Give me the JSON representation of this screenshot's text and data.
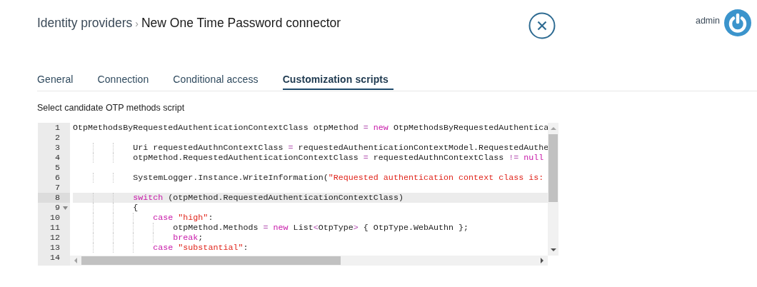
{
  "breadcrumb": [
    {
      "label": "Identity providers",
      "current": false
    },
    {
      "label": "New One Time Password connector",
      "current": true
    }
  ],
  "breadcrumb_separator": "›",
  "user": {
    "name": "admin"
  },
  "tabs": [
    {
      "label": "General",
      "selected": false
    },
    {
      "label": "Connection",
      "selected": false
    },
    {
      "label": "Conditional access",
      "selected": false
    },
    {
      "label": "Customization scripts",
      "selected": true
    }
  ],
  "script_label": "Select candidate OTP methods script",
  "editor": {
    "lines": [
      {
        "number": "1",
        "active": false,
        "tokens": [
          {
            "kind": "text",
            "text": "OtpMethodsByRequestedAuthenticationContextClass otpMethod "
          },
          {
            "kind": "operator",
            "text": "="
          },
          {
            "kind": "keyword",
            "text": " new"
          },
          {
            "kind": "text",
            "text": " OtpMethodsByRequestedAuthentica"
          }
        ]
      },
      {
        "number": "2",
        "active": false
      },
      {
        "number": "3",
        "active": false,
        "tokens": [
          {
            "kind": "text",
            "text": "            Uri requestedAuthnContextClass "
          },
          {
            "kind": "operator",
            "text": "="
          },
          {
            "kind": "text",
            "text": " requestedAuthenticationContextModel.RequestedAuthe"
          }
        ]
      },
      {
        "number": "4",
        "active": false,
        "tokens": [
          {
            "kind": "text",
            "text": "            otpMethod.RequestedAuthenticationContextClass "
          },
          {
            "kind": "operator",
            "text": "="
          },
          {
            "kind": "text",
            "text": " requestedAuthnContextClass "
          },
          {
            "kind": "operator",
            "text": "!="
          },
          {
            "kind": "keyword",
            "text": " null"
          }
        ]
      },
      {
        "number": "5",
        "active": false
      },
      {
        "number": "6",
        "active": false,
        "tokens": [
          {
            "kind": "text",
            "text": "            SystemLogger.Instance.WriteInformation("
          },
          {
            "kind": "string",
            "text": "\"Requested authentication context class is:"
          }
        ]
      },
      {
        "number": "7",
        "active": false
      },
      {
        "number": "8",
        "active": true,
        "tokens": [
          {
            "kind": "keyword",
            "text": "            switch"
          },
          {
            "kind": "text",
            "text": " (otpMethod.RequestedAuthenticationContextClass)"
          }
        ]
      },
      {
        "number": "9",
        "active": false,
        "expanded": true,
        "tokens": [
          {
            "kind": "text",
            "text": "            {"
          }
        ]
      },
      {
        "number": "10",
        "active": false,
        "tokens": [
          {
            "kind": "keyword",
            "text": "                case"
          },
          {
            "kind": "string",
            "text": " \"high\""
          },
          {
            "kind": "text",
            "text": ":"
          }
        ]
      },
      {
        "number": "11",
        "active": false,
        "tokens": [
          {
            "kind": "text",
            "text": "                    otpMethod.Methods "
          },
          {
            "kind": "operator",
            "text": "="
          },
          {
            "kind": "keyword",
            "text": " new"
          },
          {
            "kind": "text",
            "text": " List"
          },
          {
            "kind": "operator",
            "text": "<"
          },
          {
            "kind": "text",
            "text": "OtpType"
          },
          {
            "kind": "operator",
            "text": ">"
          },
          {
            "kind": "text",
            "text": " { OtpType.WebAuthn };"
          }
        ]
      },
      {
        "number": "12",
        "active": false,
        "tokens": [
          {
            "kind": "keyword",
            "text": "                    break"
          },
          {
            "kind": "text",
            "text": ";"
          }
        ]
      },
      {
        "number": "13",
        "active": false,
        "tokens": [
          {
            "kind": "keyword",
            "text": "                case"
          },
          {
            "kind": "string",
            "text": " \"substantial\""
          },
          {
            "kind": "text",
            "text": ":"
          }
        ]
      },
      {
        "number": "14",
        "active": false
      }
    ]
  }
}
